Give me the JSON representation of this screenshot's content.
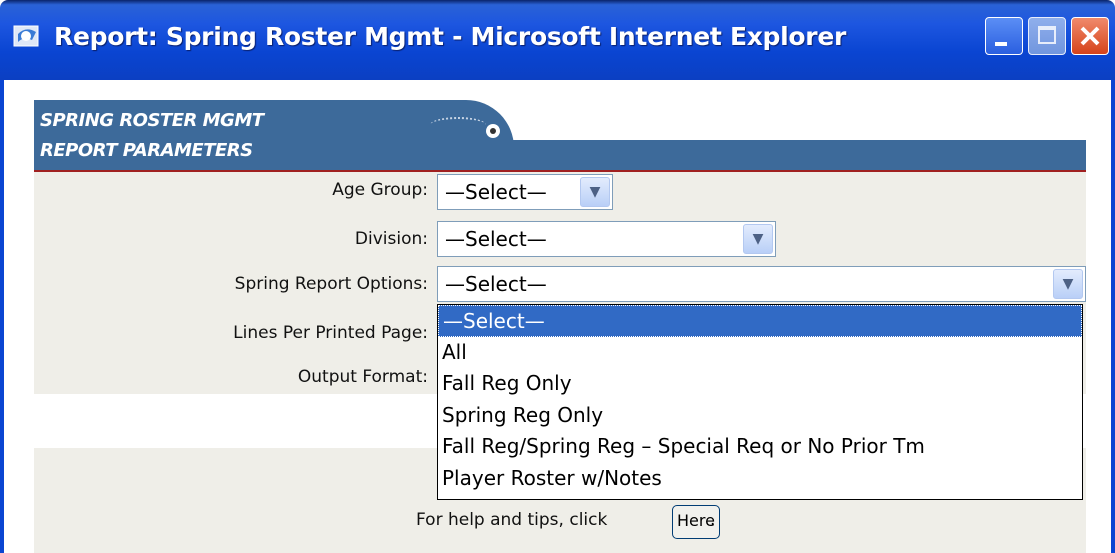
{
  "window": {
    "title": "Report: Spring Roster Mgmt - Microsoft Internet Explorer"
  },
  "header": {
    "line1": "SPRING ROSTER MGMT",
    "line2": "REPORT PARAMETERS"
  },
  "form": {
    "age_group": {
      "label": "Age Group:",
      "value": "—Select—"
    },
    "division": {
      "label": "Division:",
      "value": "—Select—"
    },
    "spring_report_options": {
      "label": "Spring Report Options:",
      "value": "—Select—"
    },
    "lines_per_page": {
      "label": "Lines Per Printed Page:"
    },
    "output_format": {
      "label": "Output Format:"
    }
  },
  "dropdown": {
    "options": [
      "—Select—",
      "All",
      "Fall Reg Only",
      "Spring Reg Only",
      "Fall Reg/Spring Reg – Special Req or No Prior Tm",
      "Player Roster w/Notes"
    ],
    "highlighted_index": 0
  },
  "help": {
    "text": "For help and tips, click",
    "button_label": "Here",
    "trailing": "."
  },
  "colors": {
    "titlebar": "#0a45d2",
    "header": "#3d6a9a",
    "panel": "#efeee8",
    "highlight": "#316ac5"
  }
}
